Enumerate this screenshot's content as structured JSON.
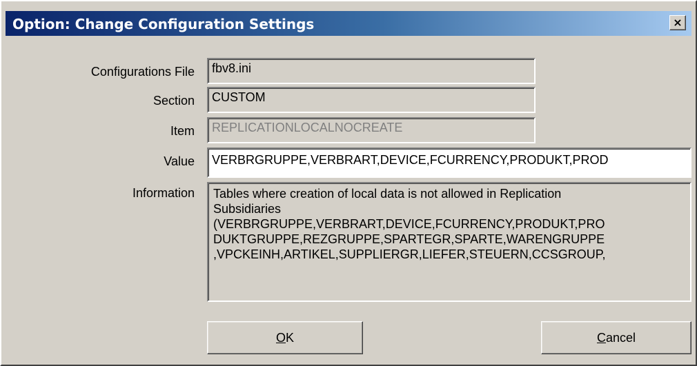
{
  "window": {
    "title": "Option: Change Configuration Settings",
    "close_glyph": "×",
    "close_icon": "close-icon"
  },
  "form": {
    "config_file": {
      "label": "Configurations File",
      "value": "fbv8.ini"
    },
    "section": {
      "label": "Section",
      "value": "CUSTOM"
    },
    "item": {
      "label": "Item",
      "value": "REPLICATIONLOCALNOCREATE"
    },
    "value": {
      "label": "Value",
      "value": "VERBRGRUPPE,VERBRART,DEVICE,FCURRENCY,PRODUKT,PROD"
    },
    "information": {
      "label": "Information",
      "line1": "Tables where creation of local data is not allowed in Replication",
      "line2": "Subsidiaries",
      "line3": "(VERBRGRUPPE,VERBRART,DEVICE,FCURRENCY,PRODUKT,PRO",
      "line4": "DUKTGRUPPE,REZGRUPPE,SPARTEGR,SPARTE,WARENGRUPPE",
      "line5": ",VPCKEINH,ARTIKEL,SUPPLIERGR,LIEFER,STEUERN,CCSGROUP,"
    }
  },
  "buttons": {
    "ok": {
      "accel": "O",
      "rest": "K"
    },
    "cancel": {
      "accel": "C",
      "rest": "ancel"
    }
  },
  "colors": {
    "dialog_bg": "#d4d0c8",
    "titlebar_start": "#0a246a",
    "titlebar_end": "#a6caf0",
    "disabled_text": "#808080"
  }
}
